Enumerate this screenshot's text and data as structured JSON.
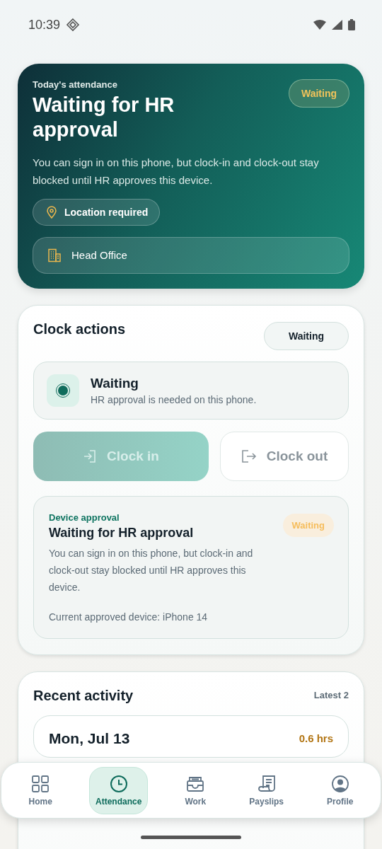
{
  "status_bar": {
    "time": "10:39"
  },
  "hero": {
    "eyebrow": "Today's attendance",
    "title": "Waiting for HR approval",
    "badge": "Waiting",
    "description": "You can sign in on this phone, but clock-in and clock-out stay blocked until HR approves this device.",
    "chip": "Location required",
    "site": "Head Office"
  },
  "clock_actions": {
    "title": "Clock actions",
    "badge": "Waiting",
    "status": {
      "title": "Waiting",
      "subtitle": "HR approval is needed on this phone."
    },
    "buttons": [
      {
        "kind": "in",
        "label": "Clock in",
        "disabled": true
      },
      {
        "kind": "out",
        "label": "Clock out",
        "disabled": true
      }
    ],
    "device": {
      "eyebrow": "Device approval",
      "title": "Waiting for HR approval",
      "badge": "Waiting",
      "description": "You can sign in on this phone, but clock-in and clock-out stay blocked until HR approves this device.",
      "current": "Current approved device: iPhone 14"
    }
  },
  "recent_activity": {
    "title": "Recent activity",
    "count": "Latest 2",
    "entries": [
      {
        "date": "Mon, Jul 13",
        "hours": "0.6 hrs"
      }
    ]
  },
  "nav": [
    {
      "kind": "home",
      "label": "Home",
      "selected": false
    },
    {
      "kind": "clock",
      "label": "Attendance",
      "selected": true
    },
    {
      "kind": "tray",
      "label": "Work",
      "selected": false
    },
    {
      "kind": "receipt",
      "label": "Payslips",
      "selected": false
    },
    {
      "kind": "person",
      "label": "Profile",
      "selected": false
    }
  ]
}
